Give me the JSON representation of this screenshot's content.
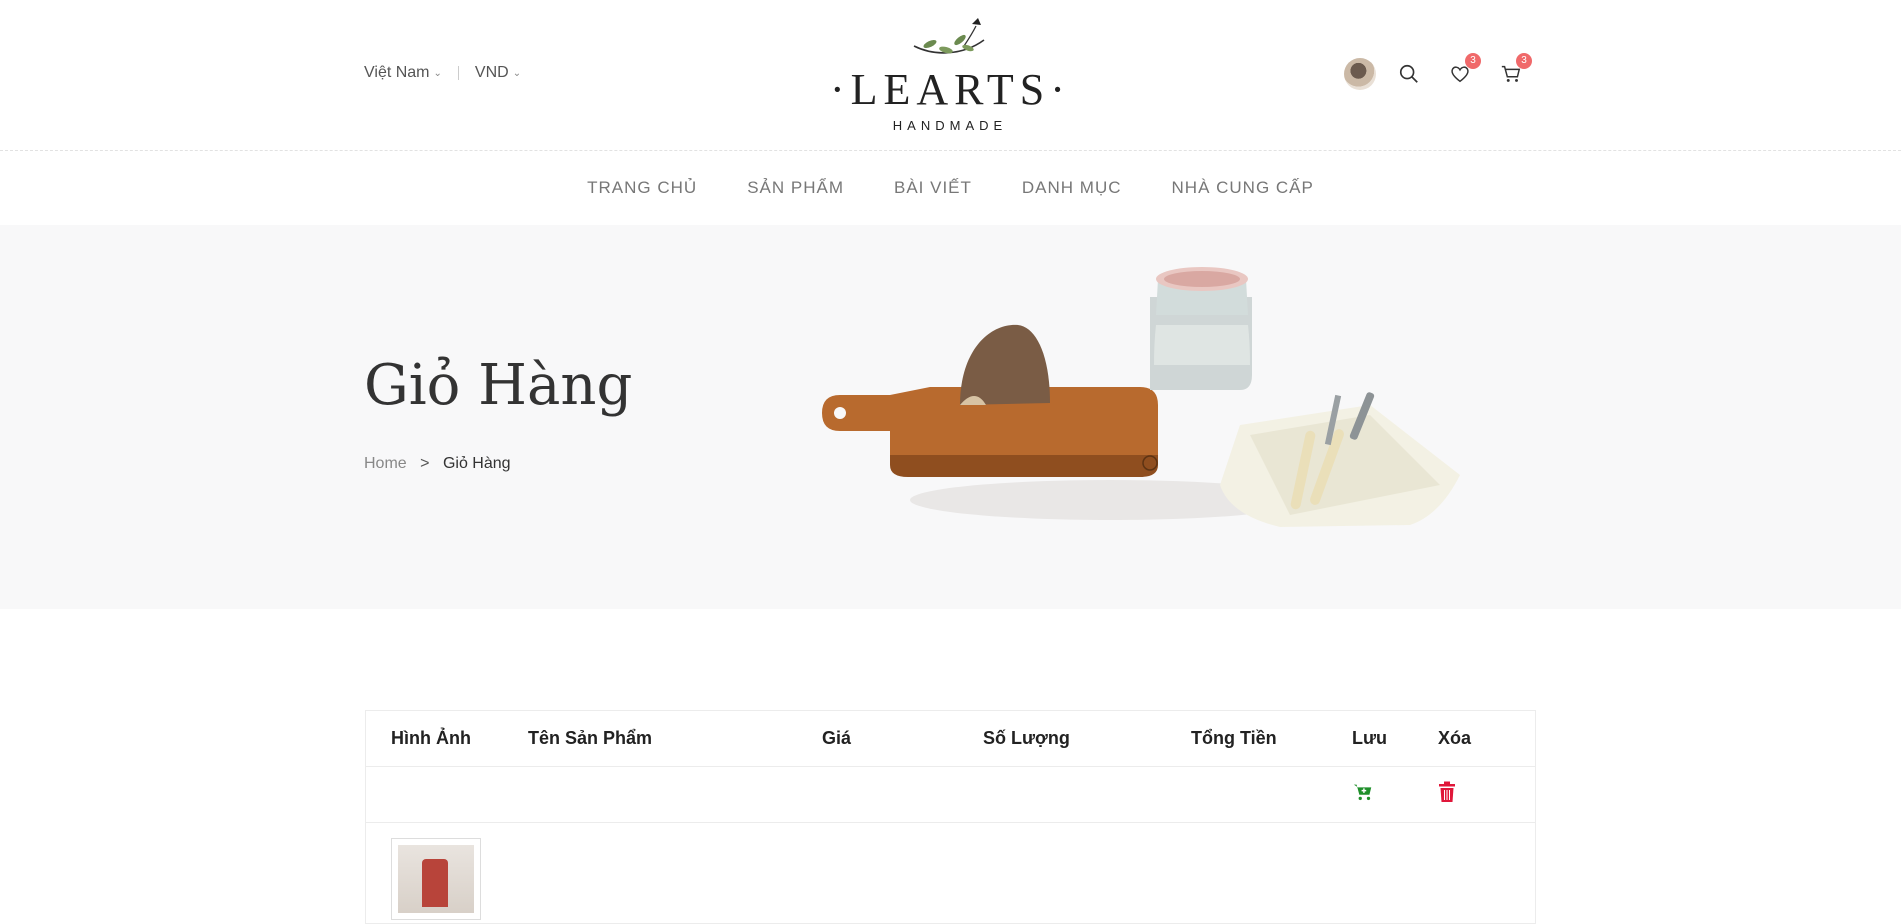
{
  "header": {
    "region": "Việt Nam",
    "currency": "VND",
    "logo_text": "LEARTS",
    "logo_sub": "HANDMADE",
    "wishlist_count": "3",
    "cart_count": "3"
  },
  "nav": {
    "items": [
      "TRANG CHỦ",
      "SẢN PHẨM",
      "BÀI VIẾT",
      "DANH MỤC",
      "NHÀ CUNG CẤP"
    ]
  },
  "hero": {
    "title": "Giỏ Hàng",
    "breadcrumb_home": "Home",
    "breadcrumb_sep": ">",
    "breadcrumb_current": "Giỏ Hàng"
  },
  "cart": {
    "headers": [
      "Hình Ảnh",
      "Tên Sản Phẩm",
      "Giá",
      "Số Lượng",
      "Tổng Tiền",
      "Lưu",
      "Xóa"
    ]
  },
  "colors": {
    "save_green": "#1f8f2a",
    "delete_red": "#e0173a",
    "badge": "#f0696a"
  },
  "icons": [
    "avatar",
    "search-icon",
    "heart-icon",
    "cart-icon",
    "cart-plus-icon",
    "trash-icon"
  ]
}
